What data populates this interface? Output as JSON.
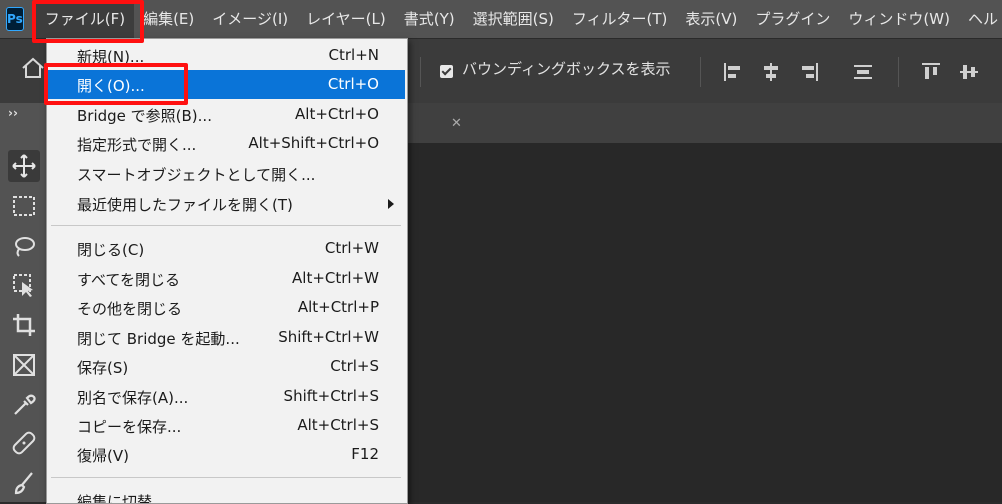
{
  "app": {
    "logo": "Ps"
  },
  "menubar": {
    "items": [
      {
        "label": "ファイル(F)"
      },
      {
        "label": "編集(E)"
      },
      {
        "label": "イメージ(I)"
      },
      {
        "label": "レイヤー(L)"
      },
      {
        "label": "書式(Y)"
      },
      {
        "label": "選択範囲(S)"
      },
      {
        "label": "フィルター(T)"
      },
      {
        "label": "表示(V)"
      },
      {
        "label": "プラグイン"
      },
      {
        "label": "ウィンドウ(W)"
      },
      {
        "label": "ヘル"
      }
    ]
  },
  "options_bar": {
    "show_bounding_box_label": "バウンディングボックスを表示",
    "show_bounding_box_checked": true
  },
  "toolbar": {
    "collapse": "››"
  },
  "file_menu": {
    "items": [
      {
        "label": "新規(N)...",
        "shortcut": "Ctrl+N"
      },
      {
        "label": "開く(O)...",
        "shortcut": "Ctrl+O",
        "highlighted": true
      },
      {
        "label": "Bridge で参照(B)...",
        "shortcut": "Alt+Ctrl+O"
      },
      {
        "label": "指定形式で開く...",
        "shortcut": "Alt+Shift+Ctrl+O"
      },
      {
        "label": "スマートオブジェクトとして開く...",
        "shortcut": ""
      },
      {
        "label": "最近使用したファイルを開く(T)",
        "shortcut": "",
        "submenu": true
      },
      {
        "label": "閉じる(C)",
        "shortcut": "Ctrl+W"
      },
      {
        "label": "すべてを閉じる",
        "shortcut": "Alt+Ctrl+W"
      },
      {
        "label": "その他を閉じる",
        "shortcut": "Alt+Ctrl+P"
      },
      {
        "label": "閉じて Bridge を起動...",
        "shortcut": "Shift+Ctrl+W"
      },
      {
        "label": "保存(S)",
        "shortcut": "Ctrl+S"
      },
      {
        "label": "別名で保存(A)...",
        "shortcut": "Shift+Ctrl+S"
      },
      {
        "label": "コピーを保存...",
        "shortcut": "Alt+Ctrl+S"
      },
      {
        "label": "復帰(V)",
        "shortcut": "F12"
      },
      {
        "label": "編集に切替",
        "shortcut": ""
      }
    ]
  },
  "colors": {
    "menu_highlight": "#0a74d8",
    "annotation_red": "#ff1010",
    "menubar_bg": "#535353"
  }
}
